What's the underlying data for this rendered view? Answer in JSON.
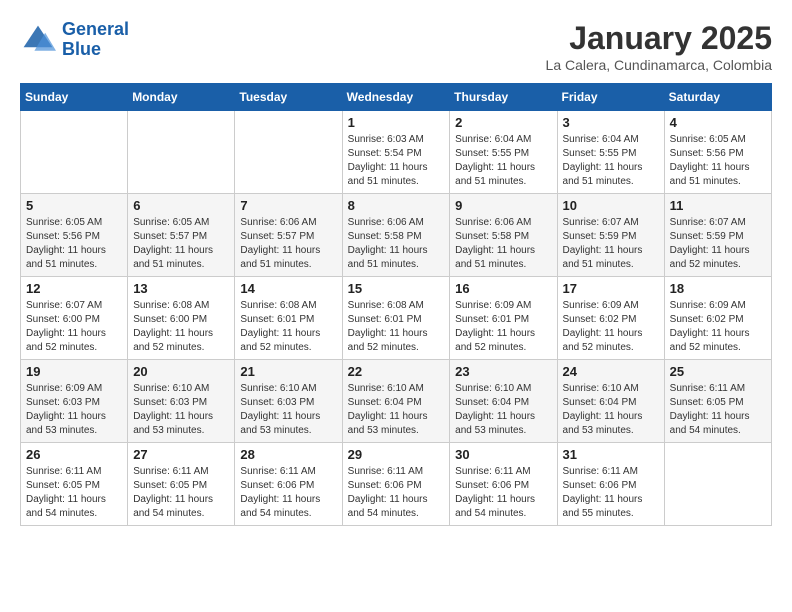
{
  "header": {
    "logo_line1": "General",
    "logo_line2": "Blue",
    "title": "January 2025",
    "subtitle": "La Calera, Cundinamarca, Colombia"
  },
  "days_of_week": [
    "Sunday",
    "Monday",
    "Tuesday",
    "Wednesday",
    "Thursday",
    "Friday",
    "Saturday"
  ],
  "weeks": [
    [
      {
        "day": "",
        "sunrise": "",
        "sunset": "",
        "daylight": ""
      },
      {
        "day": "",
        "sunrise": "",
        "sunset": "",
        "daylight": ""
      },
      {
        "day": "",
        "sunrise": "",
        "sunset": "",
        "daylight": ""
      },
      {
        "day": "1",
        "sunrise": "Sunrise: 6:03 AM",
        "sunset": "Sunset: 5:54 PM",
        "daylight": "Daylight: 11 hours and 51 minutes."
      },
      {
        "day": "2",
        "sunrise": "Sunrise: 6:04 AM",
        "sunset": "Sunset: 5:55 PM",
        "daylight": "Daylight: 11 hours and 51 minutes."
      },
      {
        "day": "3",
        "sunrise": "Sunrise: 6:04 AM",
        "sunset": "Sunset: 5:55 PM",
        "daylight": "Daylight: 11 hours and 51 minutes."
      },
      {
        "day": "4",
        "sunrise": "Sunrise: 6:05 AM",
        "sunset": "Sunset: 5:56 PM",
        "daylight": "Daylight: 11 hours and 51 minutes."
      }
    ],
    [
      {
        "day": "5",
        "sunrise": "Sunrise: 6:05 AM",
        "sunset": "Sunset: 5:56 PM",
        "daylight": "Daylight: 11 hours and 51 minutes."
      },
      {
        "day": "6",
        "sunrise": "Sunrise: 6:05 AM",
        "sunset": "Sunset: 5:57 PM",
        "daylight": "Daylight: 11 hours and 51 minutes."
      },
      {
        "day": "7",
        "sunrise": "Sunrise: 6:06 AM",
        "sunset": "Sunset: 5:57 PM",
        "daylight": "Daylight: 11 hours and 51 minutes."
      },
      {
        "day": "8",
        "sunrise": "Sunrise: 6:06 AM",
        "sunset": "Sunset: 5:58 PM",
        "daylight": "Daylight: 11 hours and 51 minutes."
      },
      {
        "day": "9",
        "sunrise": "Sunrise: 6:06 AM",
        "sunset": "Sunset: 5:58 PM",
        "daylight": "Daylight: 11 hours and 51 minutes."
      },
      {
        "day": "10",
        "sunrise": "Sunrise: 6:07 AM",
        "sunset": "Sunset: 5:59 PM",
        "daylight": "Daylight: 11 hours and 51 minutes."
      },
      {
        "day": "11",
        "sunrise": "Sunrise: 6:07 AM",
        "sunset": "Sunset: 5:59 PM",
        "daylight": "Daylight: 11 hours and 52 minutes."
      }
    ],
    [
      {
        "day": "12",
        "sunrise": "Sunrise: 6:07 AM",
        "sunset": "Sunset: 6:00 PM",
        "daylight": "Daylight: 11 hours and 52 minutes."
      },
      {
        "day": "13",
        "sunrise": "Sunrise: 6:08 AM",
        "sunset": "Sunset: 6:00 PM",
        "daylight": "Daylight: 11 hours and 52 minutes."
      },
      {
        "day": "14",
        "sunrise": "Sunrise: 6:08 AM",
        "sunset": "Sunset: 6:01 PM",
        "daylight": "Daylight: 11 hours and 52 minutes."
      },
      {
        "day": "15",
        "sunrise": "Sunrise: 6:08 AM",
        "sunset": "Sunset: 6:01 PM",
        "daylight": "Daylight: 11 hours and 52 minutes."
      },
      {
        "day": "16",
        "sunrise": "Sunrise: 6:09 AM",
        "sunset": "Sunset: 6:01 PM",
        "daylight": "Daylight: 11 hours and 52 minutes."
      },
      {
        "day": "17",
        "sunrise": "Sunrise: 6:09 AM",
        "sunset": "Sunset: 6:02 PM",
        "daylight": "Daylight: 11 hours and 52 minutes."
      },
      {
        "day": "18",
        "sunrise": "Sunrise: 6:09 AM",
        "sunset": "Sunset: 6:02 PM",
        "daylight": "Daylight: 11 hours and 52 minutes."
      }
    ],
    [
      {
        "day": "19",
        "sunrise": "Sunrise: 6:09 AM",
        "sunset": "Sunset: 6:03 PM",
        "daylight": "Daylight: 11 hours and 53 minutes."
      },
      {
        "day": "20",
        "sunrise": "Sunrise: 6:10 AM",
        "sunset": "Sunset: 6:03 PM",
        "daylight": "Daylight: 11 hours and 53 minutes."
      },
      {
        "day": "21",
        "sunrise": "Sunrise: 6:10 AM",
        "sunset": "Sunset: 6:03 PM",
        "daylight": "Daylight: 11 hours and 53 minutes."
      },
      {
        "day": "22",
        "sunrise": "Sunrise: 6:10 AM",
        "sunset": "Sunset: 6:04 PM",
        "daylight": "Daylight: 11 hours and 53 minutes."
      },
      {
        "day": "23",
        "sunrise": "Sunrise: 6:10 AM",
        "sunset": "Sunset: 6:04 PM",
        "daylight": "Daylight: 11 hours and 53 minutes."
      },
      {
        "day": "24",
        "sunrise": "Sunrise: 6:10 AM",
        "sunset": "Sunset: 6:04 PM",
        "daylight": "Daylight: 11 hours and 53 minutes."
      },
      {
        "day": "25",
        "sunrise": "Sunrise: 6:11 AM",
        "sunset": "Sunset: 6:05 PM",
        "daylight": "Daylight: 11 hours and 54 minutes."
      }
    ],
    [
      {
        "day": "26",
        "sunrise": "Sunrise: 6:11 AM",
        "sunset": "Sunset: 6:05 PM",
        "daylight": "Daylight: 11 hours and 54 minutes."
      },
      {
        "day": "27",
        "sunrise": "Sunrise: 6:11 AM",
        "sunset": "Sunset: 6:05 PM",
        "daylight": "Daylight: 11 hours and 54 minutes."
      },
      {
        "day": "28",
        "sunrise": "Sunrise: 6:11 AM",
        "sunset": "Sunset: 6:06 PM",
        "daylight": "Daylight: 11 hours and 54 minutes."
      },
      {
        "day": "29",
        "sunrise": "Sunrise: 6:11 AM",
        "sunset": "Sunset: 6:06 PM",
        "daylight": "Daylight: 11 hours and 54 minutes."
      },
      {
        "day": "30",
        "sunrise": "Sunrise: 6:11 AM",
        "sunset": "Sunset: 6:06 PM",
        "daylight": "Daylight: 11 hours and 54 minutes."
      },
      {
        "day": "31",
        "sunrise": "Sunrise: 6:11 AM",
        "sunset": "Sunset: 6:06 PM",
        "daylight": "Daylight: 11 hours and 55 minutes."
      },
      {
        "day": "",
        "sunrise": "",
        "sunset": "",
        "daylight": ""
      }
    ]
  ]
}
